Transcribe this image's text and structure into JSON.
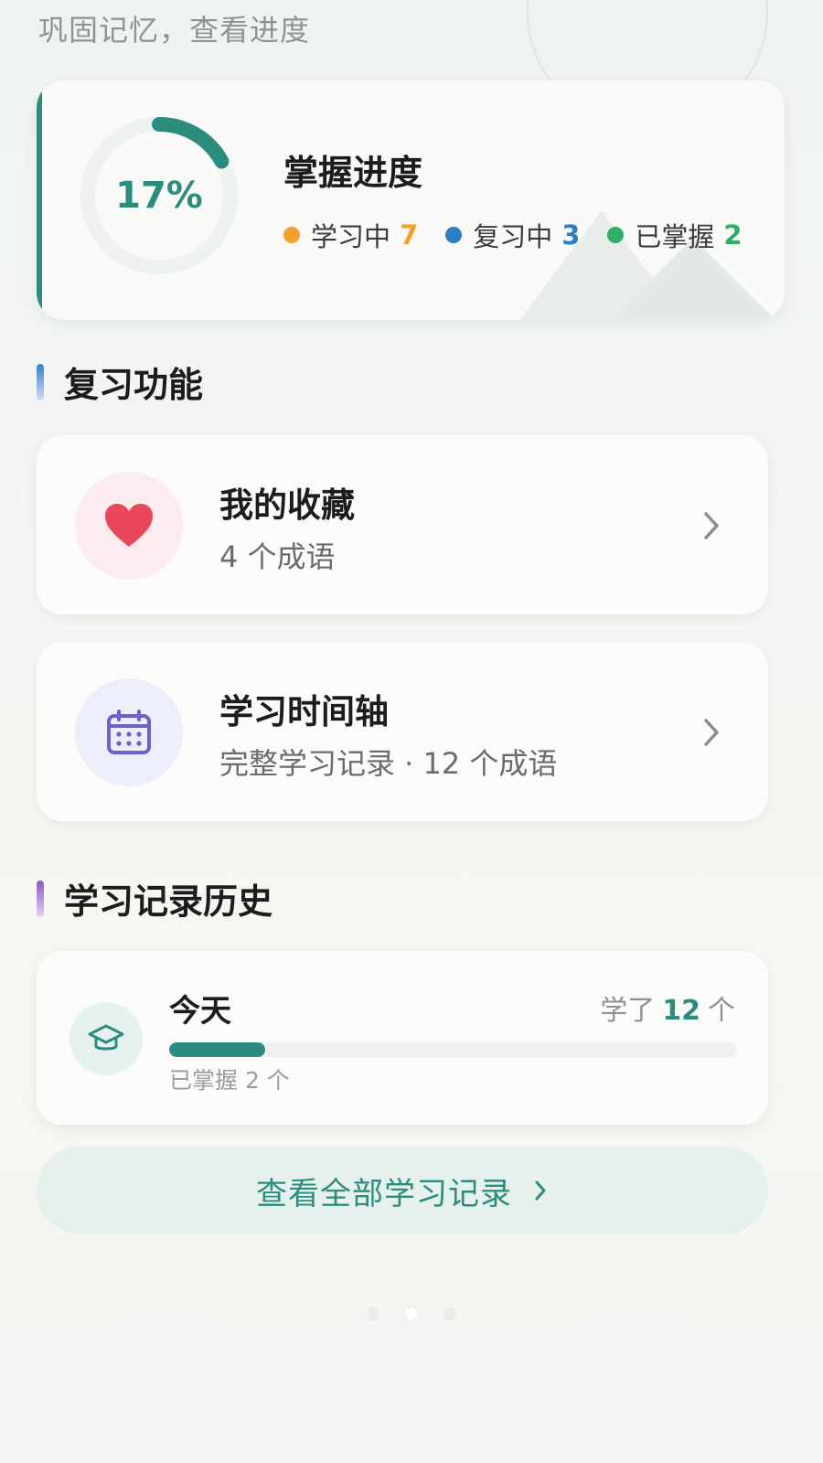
{
  "header": {
    "subtitle": "巩固记忆，查看进度"
  },
  "progress": {
    "percent": 17,
    "percent_label": "17%",
    "title": "掌握进度",
    "legend": [
      {
        "label": "学习中",
        "count": "7",
        "color": "#f3a12c"
      },
      {
        "label": "复习中",
        "count": "3",
        "color": "#2f7fc0"
      },
      {
        "label": "已掌握",
        "count": "2",
        "color": "#2fae6a"
      }
    ]
  },
  "sections": {
    "review": {
      "title": "复习功能",
      "bar_color": "#3a7fc8"
    },
    "history": {
      "title": "学习记录历史",
      "bar_color": "#8a5cc0"
    }
  },
  "favorites": {
    "title": "我的收藏",
    "subtitle": "4 个成语",
    "icon": "heart-icon",
    "color": "#e8485a"
  },
  "timeline": {
    "title": "学习时间轴",
    "subtitle": "完整学习记录 · 12 个成语",
    "icon": "calendar-icon",
    "color": "#6b63c8"
  },
  "history_entry": {
    "day": "今天",
    "learned_prefix": "学了",
    "learned_count": "12",
    "learned_suffix": "个",
    "mastered_text": "已掌握 2 个",
    "progress_fraction": 0.17,
    "icon": "graduation-cap-icon"
  },
  "view_all": {
    "label": "查看全部学习记录"
  },
  "colors": {
    "accent": "#2c8c7e"
  },
  "pager": {
    "count": 3,
    "active_index": 1
  }
}
